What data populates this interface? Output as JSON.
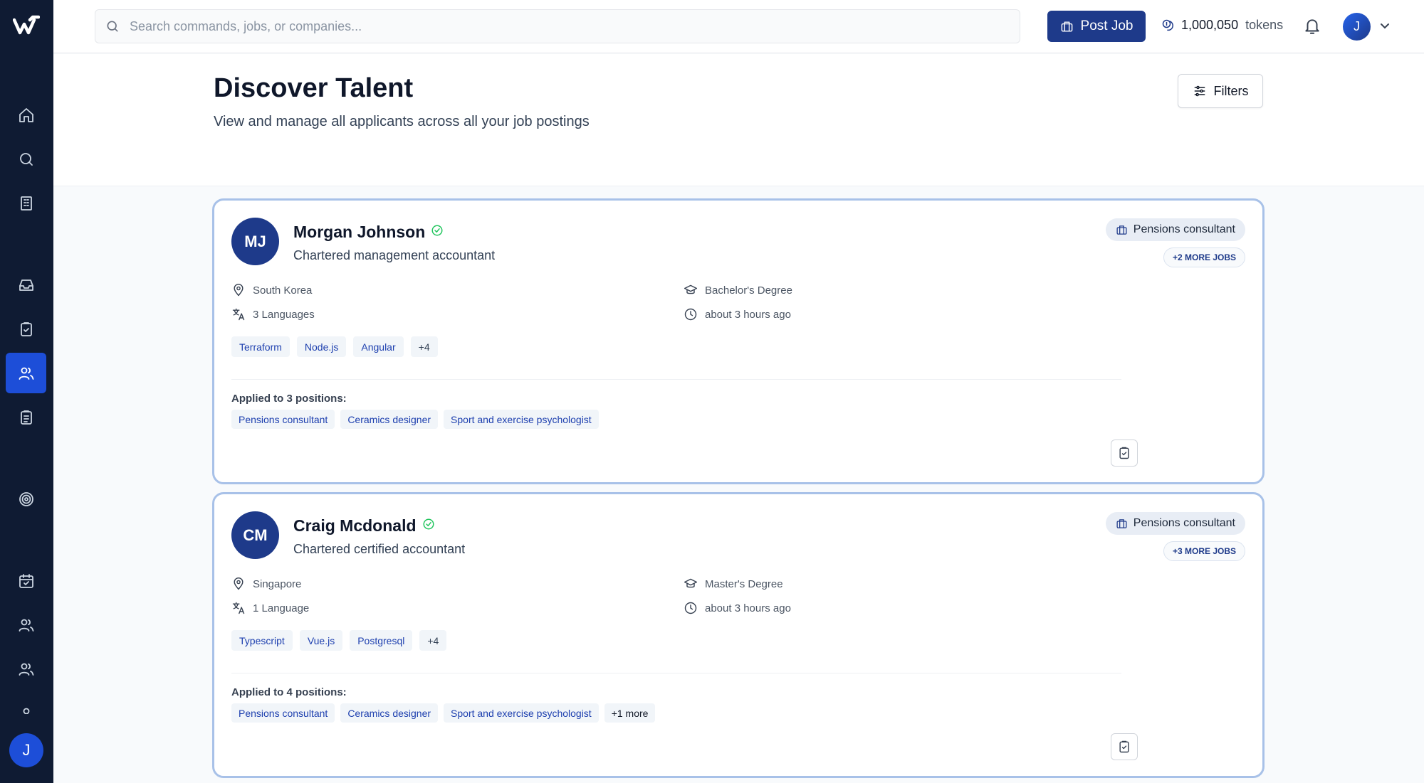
{
  "search": {
    "placeholder": "Search commands, jobs, or companies..."
  },
  "topbar": {
    "post_job_label": "Post Job",
    "tokens_value": "1,000,050",
    "tokens_unit": "tokens",
    "user_initial": "J"
  },
  "sidebar": {
    "user_initial": "J"
  },
  "header": {
    "title": "Discover Talent",
    "subtitle": "View and manage all applicants across all your job postings",
    "filters_label": "Filters"
  },
  "candidates": [
    {
      "initials": "MJ",
      "name": "Morgan Johnson",
      "role": "Chartered management accountant",
      "job_pill": "Pensions consultant",
      "more_jobs": "+2 MORE JOBS",
      "location": "South Korea",
      "languages": "3 Languages",
      "education": "Bachelor's Degree",
      "time": "about 3 hours ago",
      "skills": [
        "Terraform",
        "Node.js",
        "Angular"
      ],
      "skills_more": "+4",
      "applied_label": "Applied to 3 positions:",
      "positions": [
        "Pensions consultant",
        "Ceramics designer",
        "Sport and exercise psychologist"
      ],
      "positions_more": ""
    },
    {
      "initials": "CM",
      "name": "Craig Mcdonald",
      "role": "Chartered certified accountant",
      "job_pill": "Pensions consultant",
      "more_jobs": "+3 MORE JOBS",
      "location": "Singapore",
      "languages": "1 Language",
      "education": "Master's Degree",
      "time": "about 3 hours ago",
      "skills": [
        "Typescript",
        "Vue.js",
        "Postgresql"
      ],
      "skills_more": "+4",
      "applied_label": "Applied to 4 positions:",
      "positions": [
        "Pensions consultant",
        "Ceramics designer",
        "Sport and exercise psychologist"
      ],
      "positions_more": "+1 more"
    }
  ],
  "colors": {
    "accent": "#1e3a8a",
    "sidebar_bg": "#0f1b33",
    "active_nav": "#1d4ed8",
    "verified": "#22c55e"
  }
}
